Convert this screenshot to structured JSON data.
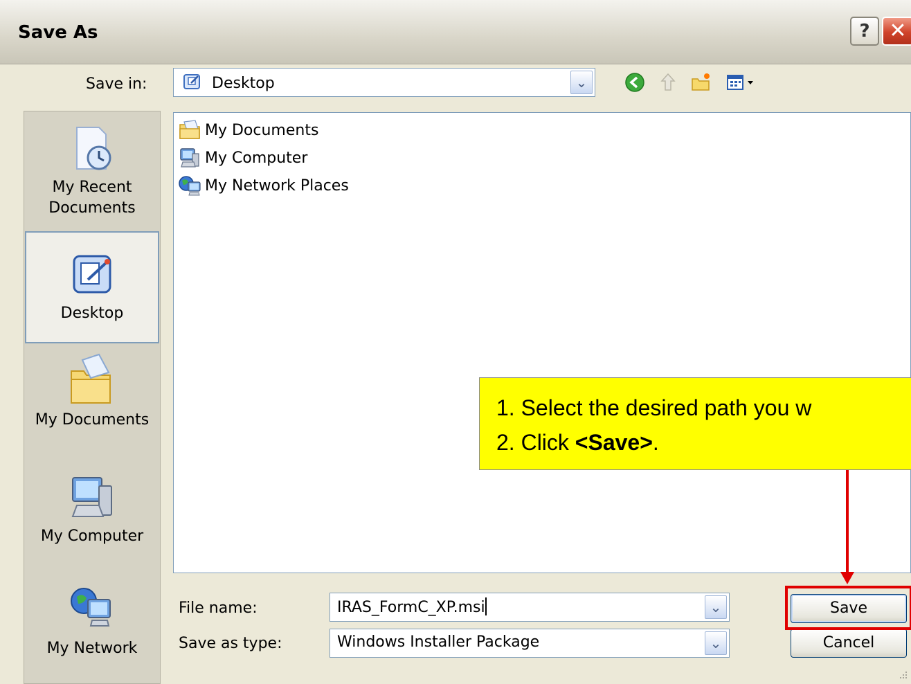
{
  "window": {
    "title": "Save As",
    "help_label": "?",
    "close_label": "✕"
  },
  "toolbar": {
    "save_in_label": "Save in:",
    "save_in_value": "Desktop",
    "icons": [
      "back-icon",
      "up-folder-icon",
      "new-folder-icon",
      "views-menu-icon"
    ]
  },
  "places": [
    {
      "label_line1": "My Recent",
      "label_line2": "Documents",
      "icon": "recent-documents-icon"
    },
    {
      "label_line1": "Desktop",
      "label_line2": "",
      "icon": "desktop-icon",
      "selected": true
    },
    {
      "label_line1": "My Documents",
      "label_line2": "",
      "icon": "my-documents-icon"
    },
    {
      "label_line1": "My Computer",
      "label_line2": "",
      "icon": "my-computer-icon"
    },
    {
      "label_line1": "My Network",
      "label_line2": "",
      "icon": "my-network-icon"
    }
  ],
  "files": [
    {
      "name": "My Documents",
      "icon": "folder-icon"
    },
    {
      "name": "My Computer",
      "icon": "computer-icon"
    },
    {
      "name": "My Network Places",
      "icon": "network-places-icon"
    }
  ],
  "form": {
    "file_name_label": "File name:",
    "file_name_value": "IRAS_FormC_XP.msi",
    "save_type_label": "Save as type:",
    "save_type_value": "Windows Installer Package"
  },
  "buttons": {
    "save": "Save",
    "cancel": "Cancel"
  },
  "annotation": {
    "line1": "1. Select the desired path you w",
    "line2_prefix": "2. Click ",
    "line2_bold": "<Save>",
    "line2_suffix": ".",
    "highlight_color": "#e00000",
    "callout_color": "#ffff00"
  }
}
